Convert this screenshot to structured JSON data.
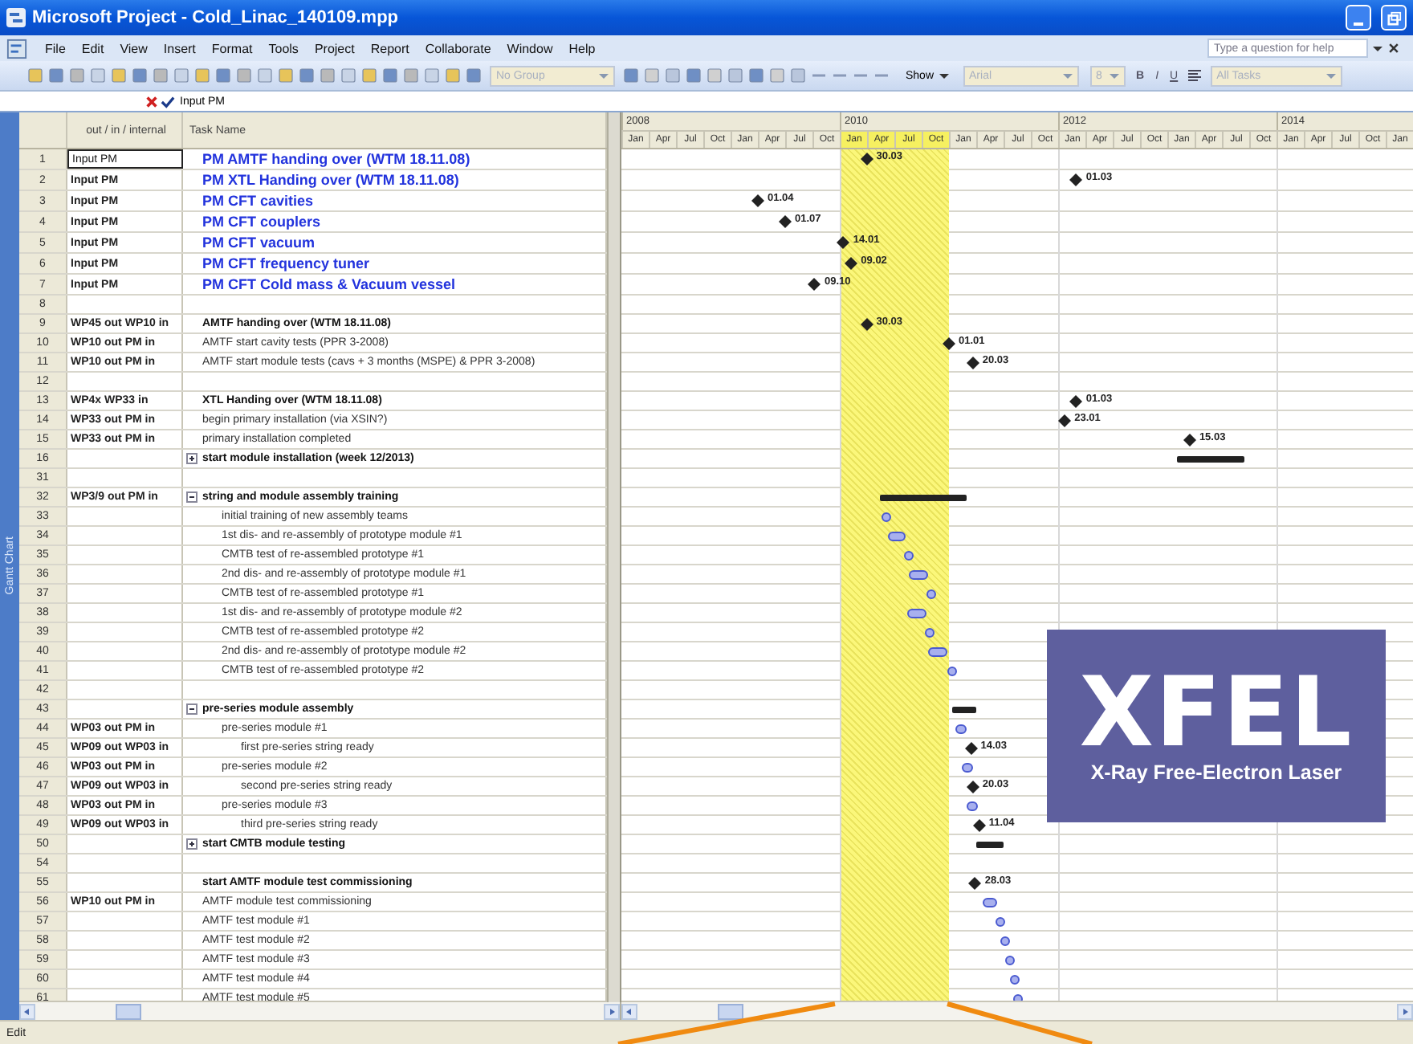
{
  "window": {
    "title": "Microsoft Project - Cold_Linac_140109.mpp"
  },
  "menu": [
    "File",
    "Edit",
    "View",
    "Insert",
    "Format",
    "Tools",
    "Project",
    "Report",
    "Collaborate",
    "Window",
    "Help"
  ],
  "help_box": {
    "placeholder": "Type a question for help"
  },
  "toolbar": {
    "group_dropdown": "No Group",
    "show_button": "Show",
    "font_dropdown": "Arial",
    "size_dropdown": "8",
    "format_buttons": [
      "B",
      "I",
      "U"
    ],
    "filter_dropdown": "All Tasks"
  },
  "edit_bar": {
    "value": "Input PM"
  },
  "side_label": "Gantt Chart",
  "columns": [
    "out / in / internal",
    "Task Name"
  ],
  "timescale": {
    "years": [
      "2008",
      "2010",
      "2012",
      "2014"
    ],
    "quarters": [
      {
        "label": "Jan",
        "highlighted": false
      },
      {
        "label": "Apr",
        "highlighted": false
      },
      {
        "label": "Jul",
        "highlighted": false
      },
      {
        "label": "Oct",
        "highlighted": false
      },
      {
        "label": "Jan",
        "highlighted": false
      },
      {
        "label": "Apr",
        "highlighted": false
      },
      {
        "label": "Jul",
        "highlighted": false
      },
      {
        "label": "Oct",
        "highlighted": false
      },
      {
        "label": "Jan",
        "highlighted": true
      },
      {
        "label": "Apr",
        "highlighted": true
      },
      {
        "label": "Jul",
        "highlighted": true
      },
      {
        "label": "Oct",
        "highlighted": true
      },
      {
        "label": "Jan",
        "highlighted": false
      },
      {
        "label": "Apr",
        "highlighted": false
      },
      {
        "label": "Jul",
        "highlighted": false
      },
      {
        "label": "Oct",
        "highlighted": false
      },
      {
        "label": "Jan",
        "highlighted": false
      },
      {
        "label": "Apr",
        "highlighted": false
      },
      {
        "label": "Jul",
        "highlighted": false
      },
      {
        "label": "Oct",
        "highlighted": false
      },
      {
        "label": "Jan",
        "highlighted": false
      },
      {
        "label": "Apr",
        "highlighted": false
      },
      {
        "label": "Jul",
        "highlighted": false
      },
      {
        "label": "Oct",
        "highlighted": false
      },
      {
        "label": "Jan",
        "highlighted": false
      },
      {
        "label": "Apr",
        "highlighted": false
      },
      {
        "label": "Jul",
        "highlighted": false
      },
      {
        "label": "Oct",
        "highlighted": false
      },
      {
        "label": "Jan",
        "highlighted": false
      }
    ]
  },
  "rows": [
    {
      "num": "1",
      "out": "Input PM",
      "task": "PM AMTF handing over (WTM 18.11.08)",
      "kind": "pm",
      "selected": true,
      "gantt": {
        "kind": "milestone",
        "label": "30.03"
      }
    },
    {
      "num": "2",
      "out": "Input PM",
      "task": "PM XTL Handing over (WTM 18.11.08)",
      "kind": "pm",
      "selected": false,
      "gantt": {
        "kind": "milestone",
        "label": "01.03"
      }
    },
    {
      "num": "3",
      "out": "Input PM",
      "task": "PM CFT cavities",
      "kind": "pm",
      "selected": false,
      "gantt": {
        "kind": "milestone",
        "label": "01.04"
      }
    },
    {
      "num": "4",
      "out": "Input PM",
      "task": "PM CFT couplers",
      "kind": "pm",
      "selected": false,
      "gantt": {
        "kind": "milestone",
        "label": "01.07"
      }
    },
    {
      "num": "5",
      "out": "Input PM",
      "task": "PM CFT vacuum",
      "kind": "pm",
      "selected": false,
      "gantt": {
        "kind": "milestone",
        "label": "14.01"
      }
    },
    {
      "num": "6",
      "out": "Input PM",
      "task": "PM CFT frequency tuner",
      "kind": "pm",
      "selected": false,
      "gantt": {
        "kind": "milestone",
        "label": "09.02"
      }
    },
    {
      "num": "7",
      "out": "Input PM",
      "task": "PM CFT Cold mass & Vacuum vessel",
      "kind": "pm",
      "selected": false,
      "gantt": {
        "kind": "milestone",
        "label": "09.10"
      }
    },
    {
      "num": "8",
      "kind": "blank",
      "selected": false
    },
    {
      "num": "9",
      "out": "WP45 out WP10 in",
      "task": "AMTF handing over (WTM 18.11.08)",
      "kind": "bold",
      "selected": false,
      "gantt": {
        "kind": "milestone",
        "label": "30.03"
      }
    },
    {
      "num": "10",
      "out": "WP10 out PM in",
      "task": "AMTF start cavity tests (PPR 3-2008)",
      "kind": "normal",
      "selected": false,
      "gantt": {
        "kind": "milestone",
        "label": "01.01"
      }
    },
    {
      "num": "11",
      "out": "WP10 out PM in",
      "task": "AMTF start module tests (cavs + 3 months (MSPE) & PPR 3-2008)",
      "kind": "normal",
      "selected": false,
      "gantt": {
        "kind": "milestone",
        "label": "20.03"
      }
    },
    {
      "num": "12",
      "kind": "blank",
      "selected": false
    },
    {
      "num": "13",
      "out": "WP4x WP33 in",
      "task": "XTL Handing over (WTM 18.11.08)",
      "kind": "bold",
      "selected": false,
      "gantt": {
        "kind": "milestone",
        "label": "01.03"
      }
    },
    {
      "num": "14",
      "out": "WP33 out PM in",
      "task": "begin primary installation (via XSIN?)",
      "kind": "normal",
      "selected": false,
      "gantt": {
        "kind": "milestone",
        "label": "23.01"
      }
    },
    {
      "num": "15",
      "out": "WP33 out PM in",
      "task": "primary installation completed",
      "kind": "normal",
      "selected": false,
      "gantt": {
        "kind": "milestone",
        "label": "15.03"
      }
    },
    {
      "num": "16",
      "task": "start module installation (week 12/2013)",
      "kind": "summary",
      "expanded": false,
      "selected": false,
      "gantt": {
        "kind": "summary"
      }
    },
    {
      "num": "31",
      "kind": "blank",
      "selected": false
    },
    {
      "num": "32",
      "out": "WP3/9 out PM in",
      "task": "string and module assembly training",
      "kind": "summary",
      "expanded": true,
      "selected": false,
      "gantt": {
        "kind": "summary"
      },
      "children": [
        {
          "num": "33",
          "task": "initial training of new assembly teams",
          "kind": "normal",
          "selected": false,
          "gantt": {
            "kind": "task"
          }
        },
        {
          "num": "34",
          "task": "1st dis- and re-assembly of prototype module #1",
          "kind": "normal",
          "selected": false,
          "gantt": {
            "kind": "task"
          }
        },
        {
          "num": "35",
          "task": "CMTB test of re-assembled prototype #1",
          "kind": "normal",
          "selected": false,
          "gantt": {
            "kind": "task"
          }
        },
        {
          "num": "36",
          "task": "2nd dis- and re-assembly of prototype module #1",
          "kind": "normal",
          "selected": false,
          "gantt": {
            "kind": "task"
          }
        },
        {
          "num": "37",
          "task": "CMTB test of re-assembled prototype #1",
          "kind": "normal",
          "selected": false,
          "gantt": {
            "kind": "task"
          }
        },
        {
          "num": "38",
          "task": "1st dis- and re-assembly of prototype module #2",
          "kind": "normal",
          "selected": false,
          "gantt": {
            "kind": "task"
          }
        },
        {
          "num": "39",
          "task": "CMTB test of re-assembled prototype #2",
          "kind": "normal",
          "selected": false,
          "gantt": {
            "kind": "task"
          }
        },
        {
          "num": "40",
          "task": "2nd dis- and re-assembly of prototype module #2",
          "kind": "normal",
          "selected": false,
          "gantt": {
            "kind": "task"
          }
        },
        {
          "num": "41",
          "task": "CMTB test of re-assembled prototype #2",
          "kind": "normal",
          "selected": false,
          "gantt": {
            "kind": "task"
          }
        }
      ]
    },
    {
      "num": "42",
      "kind": "blank",
      "selected": false
    },
    {
      "num": "43",
      "task": "pre-series module assembly",
      "kind": "summary",
      "expanded": true,
      "selected": false,
      "gantt": {
        "kind": "summary"
      },
      "children": [
        {
          "num": "44",
          "out": "WP03 out PM in",
          "task": "pre-series module #1",
          "kind": "normal",
          "selected": false,
          "gantt": {
            "kind": "task"
          },
          "children": [
            {
              "num": "45",
              "out": "WP09 out WP03 in",
              "task": "first pre-series string ready",
              "kind": "normal",
              "selected": false,
              "gantt": {
                "kind": "milestone",
                "label": "14.03"
              }
            }
          ]
        },
        {
          "num": "46",
          "out": "WP03 out PM in",
          "task": "pre-series module #2",
          "kind": "normal",
          "selected": false,
          "gantt": {
            "kind": "task"
          },
          "children": [
            {
              "num": "47",
              "out": "WP09 out WP03 in",
              "task": "second pre-series string ready",
              "kind": "normal",
              "selected": false,
              "gantt": {
                "kind": "milestone",
                "label": "20.03"
              }
            }
          ]
        },
        {
          "num": "48",
          "out": "WP03 out PM in",
          "task": "pre-series module #3",
          "kind": "normal",
          "selected": false,
          "gantt": {
            "kind": "task"
          },
          "children": [
            {
              "num": "49",
              "out": "WP09 out WP03 in",
              "task": "third pre-series string ready",
              "kind": "normal",
              "selected": false,
              "gantt": {
                "kind": "milestone",
                "label": "11.04"
              }
            }
          ]
        }
      ]
    },
    {
      "num": "50",
      "task": "start CMTB module testing",
      "kind": "summary",
      "expanded": false,
      "selected": false,
      "gantt": {
        "kind": "summary"
      }
    },
    {
      "num": "54",
      "kind": "blank",
      "selected": false
    },
    {
      "num": "55",
      "task": "start AMTF module test commissioning",
      "kind": "bold",
      "selected": false,
      "gantt": {
        "kind": "milestone",
        "label": "28.03"
      }
    },
    {
      "num": "56",
      "out": "WP10 out PM in",
      "task": "AMTF module test commissioning",
      "kind": "normal",
      "selected": false,
      "gantt": {
        "kind": "task"
      }
    },
    {
      "num": "57",
      "task": "AMTF test module #1",
      "kind": "normal",
      "selected": false,
      "gantt": {
        "kind": "task"
      }
    },
    {
      "num": "58",
      "task": "AMTF test module #2",
      "kind": "normal",
      "selected": false,
      "gantt": {
        "kind": "task"
      }
    },
    {
      "num": "59",
      "task": "AMTF test module #3",
      "kind": "normal",
      "selected": false,
      "gantt": {
        "kind": "task"
      }
    },
    {
      "num": "60",
      "task": "AMTF test module #4",
      "kind": "normal",
      "selected": false,
      "gantt": {
        "kind": "task"
      }
    },
    {
      "num": "61",
      "task": "AMTF test module #5",
      "kind": "normal",
      "selected": false,
      "gantt": {
        "kind": "task"
      }
    }
  ],
  "logo": {
    "title": "XFEL",
    "subtitle": "X-Ray Free-Electron Laser"
  },
  "status_bar": {
    "mode": "Edit"
  }
}
